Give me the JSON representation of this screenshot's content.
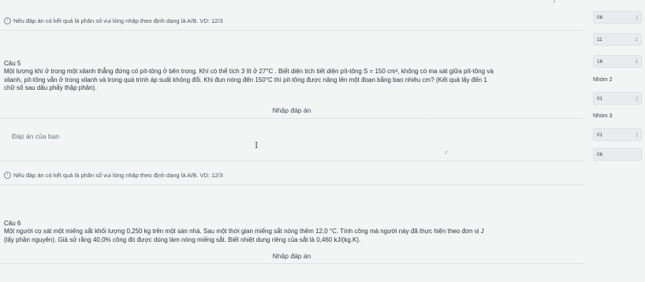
{
  "note_text": "Nếu đáp án có kết quả là phân số vui lòng nhập theo định dạng là A/B. VD: 12/3",
  "q5": {
    "title": "Câu 5",
    "line1": "Một lượng khí ở trong một xilanh thẳng đứng có pít-tông ở bên trong. Khí có thể tích 3 lít ở 27°C . Biết diện tích tiết diện pít-tông S = 150 cm², không có ma sát giữa pít-tông và",
    "line2": "xilanh, pít-tông vẫn ở trong xilanh và trong quá trình áp suất không đổi. Khi đun nóng đến 150°C thì pít-tông được nâng lên một đoạn bằng bao nhiêu cm? (Kết quả lấy đến 1",
    "line3": "chữ số sau dấu phẩy thập phân).",
    "enter_answer": "Nhập đáp án",
    "answer_label": "Đáp án của bạn",
    "answer_value": ""
  },
  "q6": {
    "title": "Câu 6",
    "line1": "Một người cọ xát một miếng sắt khối lượng 0,250 kg trên một sàn nhà. Sau một thời gian miếng sắt nóng thêm 12,0 °C. Tính công mà người này đã thực hiện theo đơn vị J",
    "line2": "(lấy phần nguyên). Giả sử rằng 40,0% công đó được dùng làm nóng miếng sắt. Biết nhiệt dung riêng của sắt là 0,460 kJ/(kg.K).",
    "enter_answer": "Nhập đáp án"
  },
  "sidebar": {
    "chip_06_top": "06",
    "chip_11": "11",
    "chip_16": "16",
    "group2": "Nhóm 2",
    "chip_01_a": "01",
    "group3": "Nhóm 3",
    "chip_01_b": "01",
    "chip_06_b": "06"
  }
}
